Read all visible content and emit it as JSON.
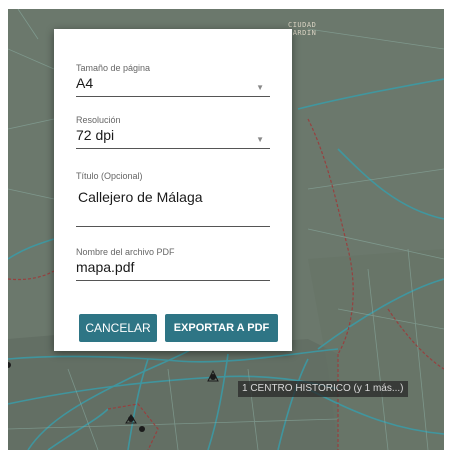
{
  "map": {
    "district_label_line1": "CIUDAD",
    "district_label_line2": "JARDIN",
    "tooltip": "1 CENTRO HISTORICO (y 1 más...)"
  },
  "dialog": {
    "page_size": {
      "label": "Tamaño de página",
      "value": "A4"
    },
    "resolution": {
      "label": "Resolución",
      "value": "72 dpi"
    },
    "title": {
      "label": "Título (Opcional)",
      "value": "Callejero de Málaga"
    },
    "filename": {
      "label": "Nombre del archivo PDF",
      "value": "mapa.pdf"
    },
    "cancel_label": "CANCELAR",
    "export_label": "EXPORTAR A PDF",
    "button_color": "#2e7585"
  },
  "icons": {
    "dropdown": "triangle-down-icon"
  }
}
